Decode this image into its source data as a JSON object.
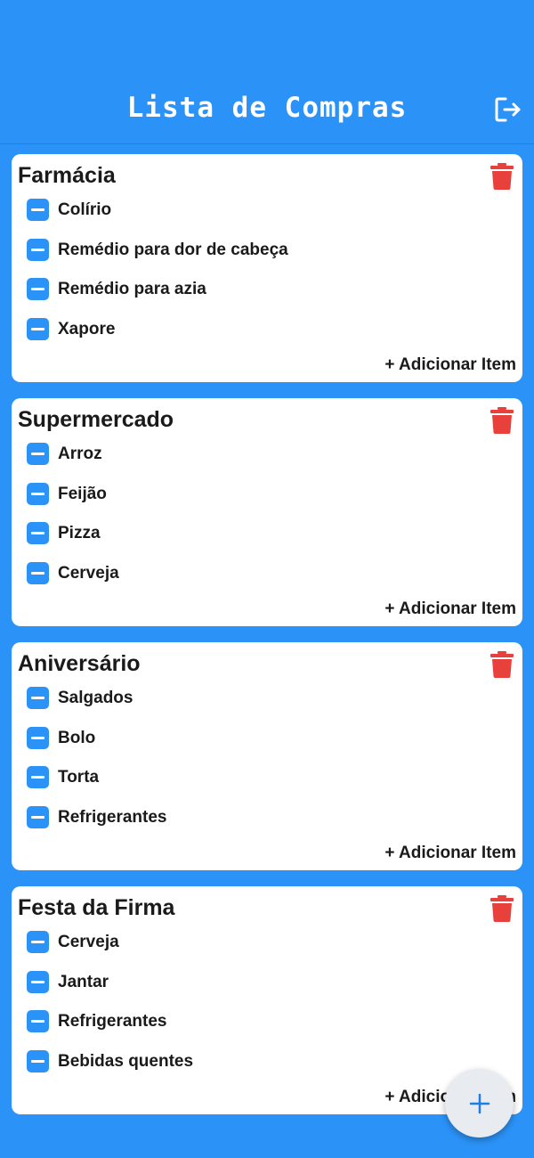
{
  "app": {
    "title": "Lista de Compras",
    "logout_icon": "logout-icon"
  },
  "colors": {
    "primary": "#2B93F8",
    "card": "#ffffff",
    "delete": "#E8403B",
    "fab_background": "#E8EBEF",
    "text": "#1a1a1a"
  },
  "lists": [
    {
      "name": "Farmácia",
      "items": [
        "Colírio",
        "Remédio para dor de cabeça",
        "Remédio para azia",
        "Xapore"
      ],
      "add_label": "+ Adicionar Item"
    },
    {
      "name": "Supermercado",
      "items": [
        "Arroz",
        "Feijão",
        "Pizza",
        "Cerveja"
      ],
      "add_label": "+ Adicionar Item"
    },
    {
      "name": "Aniversário",
      "items": [
        "Salgados",
        "Bolo",
        "Torta",
        "Refrigerantes"
      ],
      "add_label": "+ Adicionar Item"
    },
    {
      "name": "Festa da Firma",
      "items": [
        "Cerveja",
        "Jantar",
        "Refrigerantes",
        "Bebidas quentes"
      ],
      "add_label": "+ Adicionar Item"
    }
  ],
  "fab": {
    "icon": "plus-icon"
  }
}
